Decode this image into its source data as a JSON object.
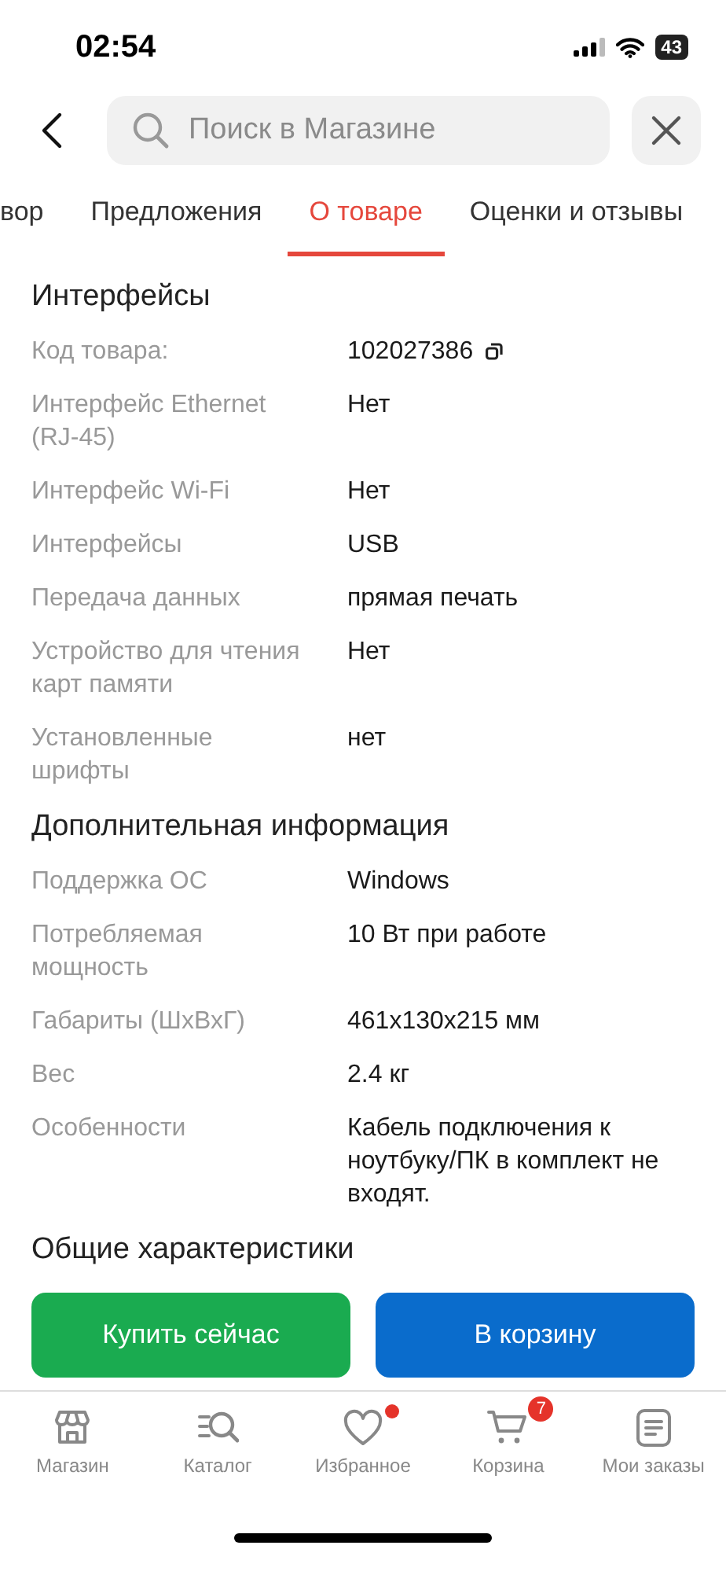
{
  "status_bar": {
    "time": "02:54",
    "battery": "43"
  },
  "header": {
    "search_placeholder": "Поиск в Магазине"
  },
  "tabs": [
    {
      "label": "вор",
      "selected": false
    },
    {
      "label": "Предложения",
      "selected": false
    },
    {
      "label": "О товаре",
      "selected": true
    },
    {
      "label": "Оценки и отзывы",
      "selected": false
    }
  ],
  "sections": [
    {
      "title": "Интерфейсы",
      "rows": [
        {
          "label": "Код товара:",
          "value": "102027386",
          "copyable": true
        },
        {
          "label": "Интерфейс Ethernet (RJ-45)",
          "value": "Нет"
        },
        {
          "label": "Интерфейс Wi-Fi",
          "value": "Нет"
        },
        {
          "label": "Интерфейсы",
          "value": "USB"
        },
        {
          "label": "Передача данных",
          "value": "прямая печать"
        },
        {
          "label": "Устройство для чтения карт памяти",
          "value": "Нет"
        },
        {
          "label": "Установленные шрифты",
          "value": "нет"
        }
      ]
    },
    {
      "title": "Дополнительная информация",
      "rows": [
        {
          "label": "Поддержка ОС",
          "value": "Windows"
        },
        {
          "label": "Потребляемая мощность",
          "value": "10 Вт при работе"
        },
        {
          "label": "Габариты (ШхВхГ)",
          "value": "461x130x215 мм"
        },
        {
          "label": "Вес",
          "value": "2.4 кг"
        },
        {
          "label": "Особенности",
          "value": "Кабель подключения к ноутбуку/ПК в комплект не входят."
        }
      ]
    },
    {
      "title": "Общие характеристики"
    }
  ],
  "actions": [
    {
      "label": "Купить сейчас",
      "kind": "buy"
    },
    {
      "label": "В корзину",
      "kind": "cart"
    }
  ],
  "nav": [
    {
      "label": "Магазин"
    },
    {
      "label": "Каталог"
    },
    {
      "label": "Избранное",
      "dot": true
    },
    {
      "label": "Корзина",
      "badge": "7"
    },
    {
      "label": "Мои заказы"
    }
  ]
}
